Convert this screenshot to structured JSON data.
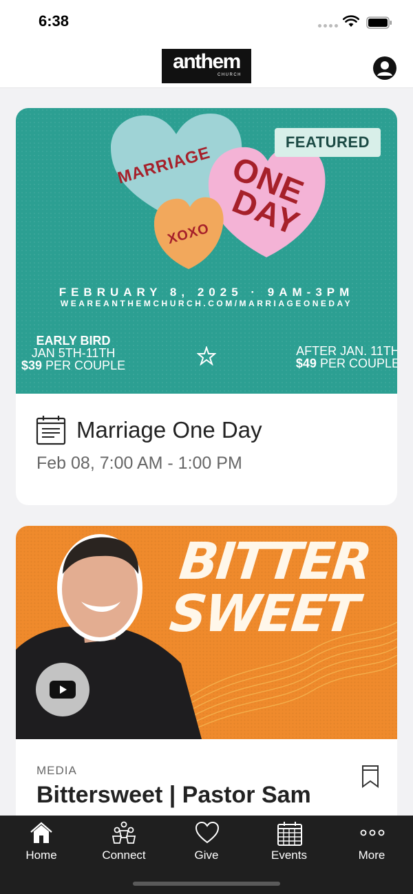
{
  "status_bar": {
    "time": "6:38"
  },
  "header": {
    "logo_word": "anthem",
    "logo_sub": "CHURCH",
    "profile_icon": "person-circle-icon"
  },
  "featured_card": {
    "badge": "FEATURED",
    "banner": {
      "heart_left": "MARRIAGE",
      "heart_right_line1": "ONE",
      "heart_right_line2": "DAY",
      "heart_small": "XOXO",
      "date_line": "FEBRUARY 8, 2025 · 9AM-3PM",
      "url_line": "WEAREANTHEMCHURCH.COM/MARRIAGEONEDAY",
      "early_bird_title": "EARLY BIRD",
      "early_bird_dates": "JAN 5TH-11TH",
      "early_bird_price": "$39",
      "early_bird_price_suffix": " PER COUPLE",
      "after_title": "AFTER JAN. 11TH",
      "after_price": "$49",
      "after_price_suffix": " PER COUPLE",
      "colors": {
        "teal": "#2c9f92",
        "heart_blue": "#9fd3d6",
        "heart_pink": "#f4b3d6",
        "heart_orange": "#f2a85c",
        "text_red": "#a6202a"
      }
    },
    "title": "Marriage One Day",
    "time": "Feb 08, 7:00 AM - 1:00 PM",
    "icon": "calendar-document-icon"
  },
  "media_card": {
    "banner_line1": "BITTER",
    "banner_line2": "SWEET",
    "label": "MEDIA",
    "title": "Bittersweet | Pastor Sam",
    "colors": {
      "orange": "#ef8a2c"
    }
  },
  "tabs": [
    {
      "label": "Home",
      "icon": "home-icon"
    },
    {
      "label": "Connect",
      "icon": "people-icon"
    },
    {
      "label": "Give",
      "icon": "heart-icon"
    },
    {
      "label": "Events",
      "icon": "calendar-icon"
    },
    {
      "label": "More",
      "icon": "more-dots-icon"
    }
  ]
}
